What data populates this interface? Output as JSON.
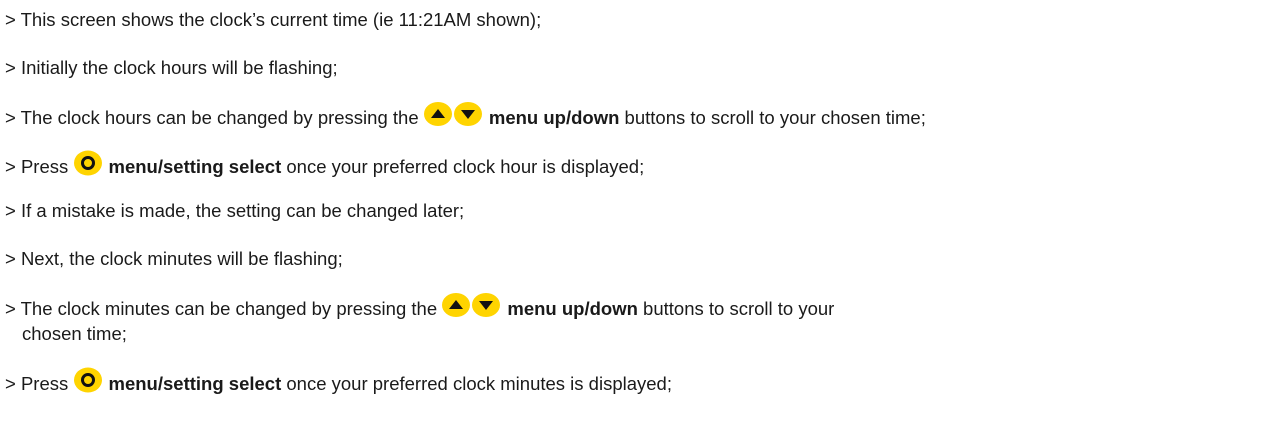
{
  "accent_color": "#FFD400",
  "icons": {
    "up_down": "up-down-arrow-buttons-icon",
    "select": "circle-select-button-icon"
  },
  "lines": {
    "l1": "> This screen shows the clock’s current time (ie 11:21AM shown);",
    "l2": "> Initially the clock hours will be flashing;",
    "l3_pre": "> The clock hours can be changed by pressing the",
    "l3_bold": "menu up/down",
    "l3_post": "buttons to scroll to your chosen time;",
    "l4_pre": "> Press",
    "l4_bold": "menu/setting select",
    "l4_post": "once your preferred clock hour is displayed;",
    "l5": "> If a mistake is made, the setting can be changed later;",
    "l6": "> Next, the clock minutes will be flashing;",
    "l7_pre": "> The clock minutes can be changed by pressing the",
    "l7_bold": "menu up/down",
    "l7_post": "buttons to scroll to your",
    "l7_cont": "chosen time;",
    "l8_pre": "> Press",
    "l8_bold": "menu/setting select",
    "l8_post": "once your preferred clock minutes is displayed;"
  }
}
